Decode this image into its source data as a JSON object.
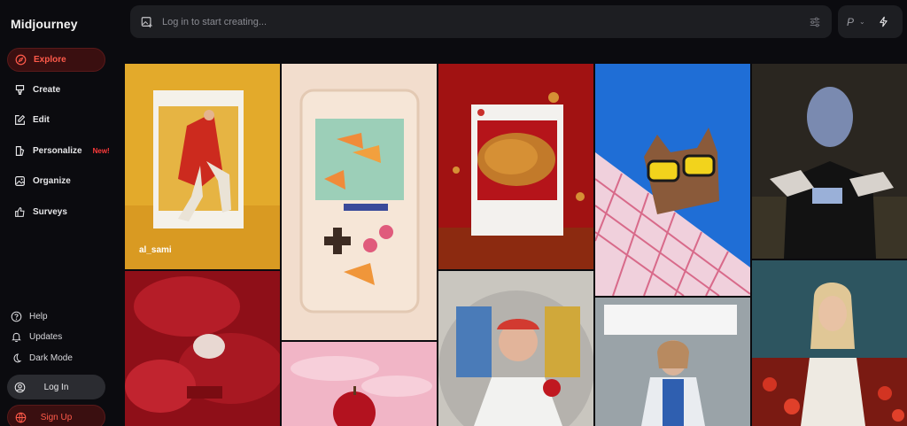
{
  "app": {
    "title": "Midjourney"
  },
  "sidebar": {
    "items": [
      {
        "label": "Explore",
        "icon": "compass-icon"
      },
      {
        "label": "Create",
        "icon": "brush-icon"
      },
      {
        "label": "Edit",
        "icon": "edit-icon"
      },
      {
        "label": "Personalize",
        "icon": "personalize-icon",
        "badge": "New!"
      },
      {
        "label": "Organize",
        "icon": "image-icon"
      },
      {
        "label": "Surveys",
        "icon": "thumbs-up-icon"
      }
    ],
    "utility": [
      {
        "label": "Help",
        "icon": "help-icon"
      },
      {
        "label": "Updates",
        "icon": "bell-icon"
      },
      {
        "label": "Dark Mode",
        "icon": "moon-icon"
      }
    ],
    "login_label": "Log In",
    "signup_label": "Sign Up"
  },
  "search": {
    "placeholder": "Log in to start creating..."
  },
  "mode": {
    "label": "P"
  },
  "gallery": {
    "tiles": [
      {
        "caption": "al_sami"
      }
    ]
  },
  "colors": {
    "accent": "#ff5a4a",
    "accent_bg": "#3a0f10",
    "panel": "#1d1e22",
    "background": "#0b0b0f"
  }
}
